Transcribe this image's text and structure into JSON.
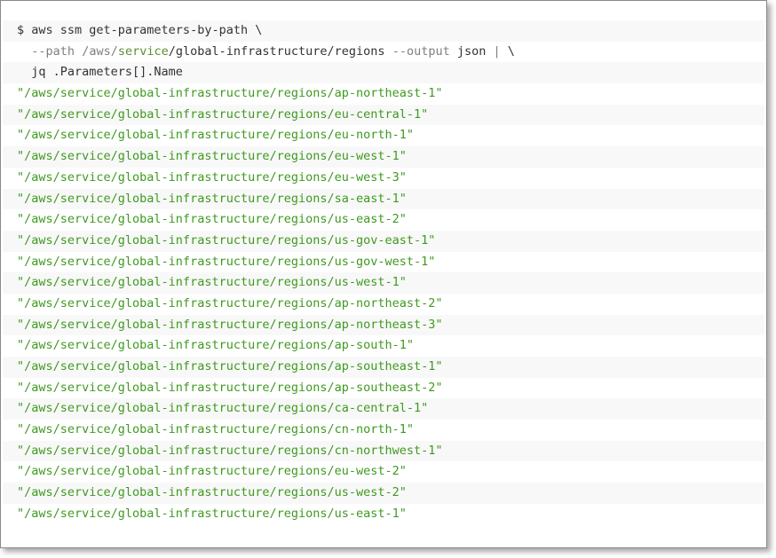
{
  "command": {
    "line1": "$ aws ssm get-parameters-by-path \\",
    "line2_indent": "  ",
    "line2_opt": "--path",
    "line2_sp": " ",
    "line2_path_a": "/aws/",
    "line2_path_b": "service",
    "line2_path_c": "/global-infrastructure/regions",
    "line2_sp2": " ",
    "line2_opt2": "--output",
    "line2_val": " json ",
    "line2_pipe": "|",
    "line2_cont": " \\",
    "line3": "  jq .Parameters[].Name"
  },
  "output_lines": [
    "\"/aws/service/global-infrastructure/regions/ap-northeast-1\"",
    "\"/aws/service/global-infrastructure/regions/eu-central-1\"",
    "\"/aws/service/global-infrastructure/regions/eu-north-1\"",
    "\"/aws/service/global-infrastructure/regions/eu-west-1\"",
    "\"/aws/service/global-infrastructure/regions/eu-west-3\"",
    "\"/aws/service/global-infrastructure/regions/sa-east-1\"",
    "\"/aws/service/global-infrastructure/regions/us-east-2\"",
    "\"/aws/service/global-infrastructure/regions/us-gov-east-1\"",
    "\"/aws/service/global-infrastructure/regions/us-gov-west-1\"",
    "\"/aws/service/global-infrastructure/regions/us-west-1\"",
    "\"/aws/service/global-infrastructure/regions/ap-northeast-2\"",
    "\"/aws/service/global-infrastructure/regions/ap-northeast-3\"",
    "\"/aws/service/global-infrastructure/regions/ap-south-1\"",
    "\"/aws/service/global-infrastructure/regions/ap-southeast-1\"",
    "\"/aws/service/global-infrastructure/regions/ap-southeast-2\"",
    "\"/aws/service/global-infrastructure/regions/ca-central-1\"",
    "\"/aws/service/global-infrastructure/regions/cn-north-1\"",
    "\"/aws/service/global-infrastructure/regions/cn-northwest-1\"",
    "\"/aws/service/global-infrastructure/regions/eu-west-2\"",
    "\"/aws/service/global-infrastructure/regions/us-west-2\"",
    "\"/aws/service/global-infrastructure/regions/us-east-1\""
  ],
  "colors": {
    "string": "#3e9a1f",
    "text": "#333333",
    "stripe": "#f8f8f8"
  }
}
